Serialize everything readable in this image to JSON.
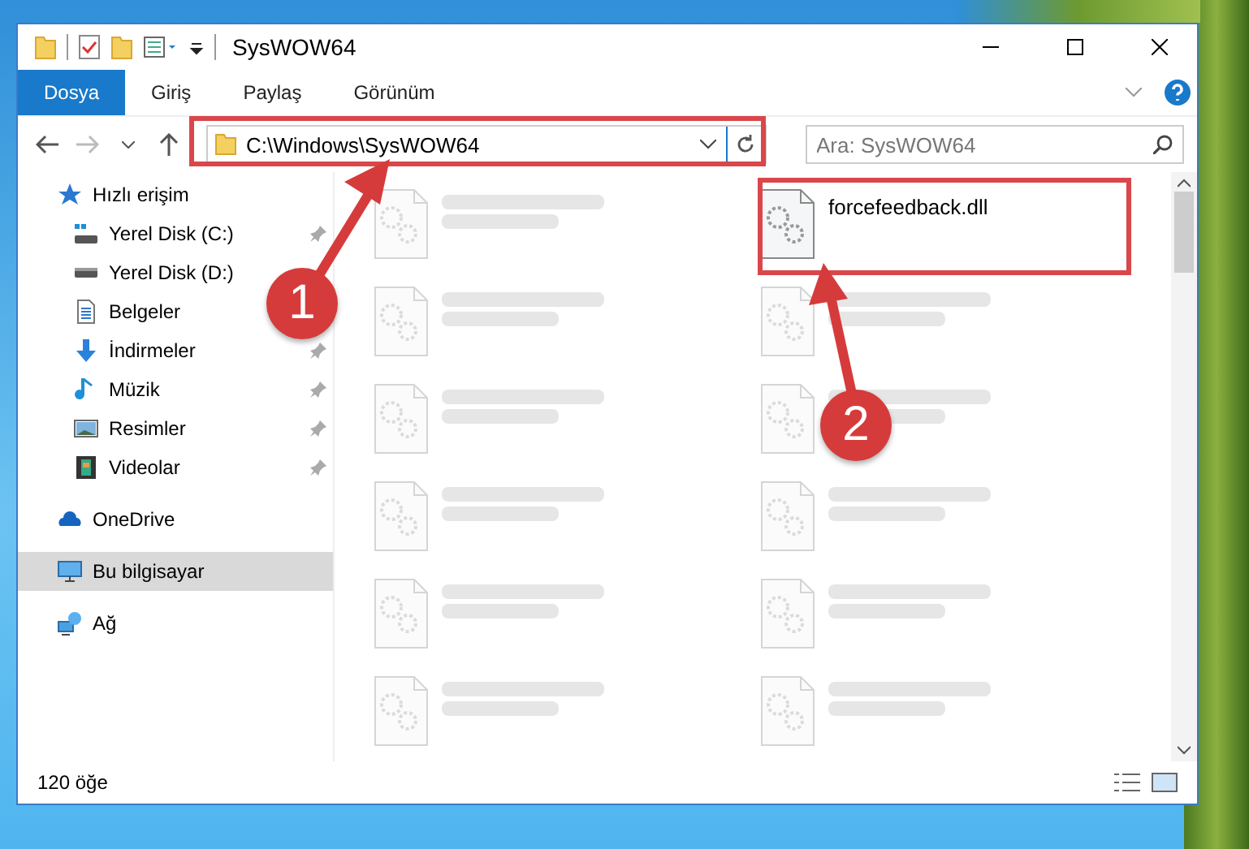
{
  "window": {
    "title": "SysWOW64"
  },
  "ribbon_tabs": [
    {
      "label": "Dosya",
      "selected": true
    },
    {
      "label": "Giriş",
      "selected": false
    },
    {
      "label": "Paylaş",
      "selected": false
    },
    {
      "label": "Görünüm",
      "selected": false
    }
  ],
  "address_bar": {
    "value": "C:\\Windows\\SysWOW64"
  },
  "search": {
    "placeholder": "Ara: SysWOW64"
  },
  "sidebar": {
    "items": [
      {
        "label": "Hızlı erişim",
        "kind": "star",
        "selected": false,
        "children": [
          {
            "label": "Yerel Disk (C:)",
            "kind": "drive-c",
            "pinned": true,
            "selected": false
          },
          {
            "label": "Yerel Disk (D:)",
            "kind": "drive",
            "pinned": false,
            "selected": false
          },
          {
            "label": "Belgeler",
            "kind": "document",
            "pinned": false,
            "selected": false
          },
          {
            "label": "İndirmeler",
            "kind": "download",
            "pinned": true,
            "selected": false
          },
          {
            "label": "Müzik",
            "kind": "music",
            "pinned": true,
            "selected": false
          },
          {
            "label": "Resimler",
            "kind": "picture",
            "pinned": true,
            "selected": false
          },
          {
            "label": "Videolar",
            "kind": "video",
            "pinned": true,
            "selected": false
          }
        ]
      },
      {
        "label": "OneDrive",
        "kind": "cloud",
        "selected": false
      },
      {
        "label": "Bu bilgisayar",
        "kind": "computer",
        "selected": true
      },
      {
        "label": "Ağ",
        "kind": "network",
        "selected": false
      }
    ]
  },
  "files": [
    {
      "faded": true
    },
    {
      "name": "forcefeedback.dll",
      "faded": false
    },
    {
      "faded": true
    },
    {
      "faded": true
    },
    {
      "faded": true
    },
    {
      "faded": true
    },
    {
      "faded": true
    },
    {
      "faded": true
    },
    {
      "faded": true
    },
    {
      "faded": true
    },
    {
      "faded": true
    },
    {
      "faded": true
    }
  ],
  "status_bar": {
    "item_count": "120 öğe"
  },
  "annotations": [
    {
      "number": "1"
    },
    {
      "number": "2"
    }
  ]
}
